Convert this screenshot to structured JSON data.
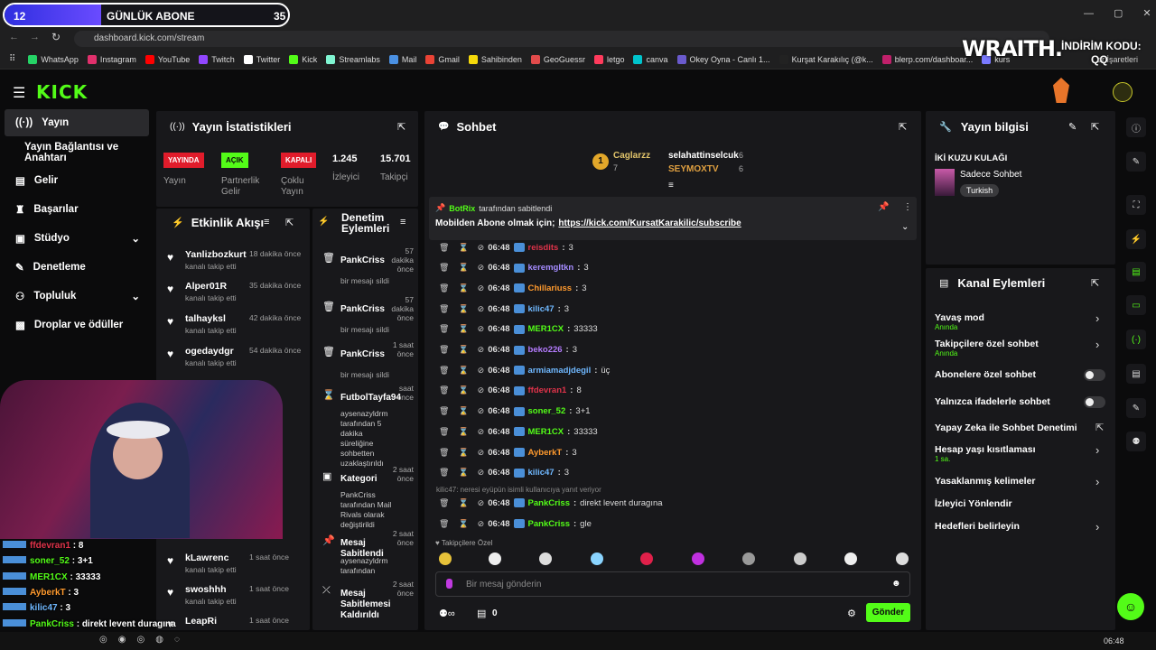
{
  "sub_goal": {
    "current": "12",
    "label": "GÜNLÜK ABONE",
    "target": "35",
    "progress": 0.34
  },
  "browser": {
    "url": "dashboard.kick.com/stream",
    "other_bookmarks": "er İşaretleri"
  },
  "bookmarks": [
    "WhatsApp",
    "Instagram",
    "YouTube",
    "Twitch",
    "Twitter",
    "Kick",
    "Streamlabs",
    "Mail",
    "Gmail",
    "Sahibinden",
    "GeoGuessr",
    "letgo",
    "canva",
    "Okey Oyna - Canlı 1...",
    "Kurşat Karakılıç (@k...",
    "blerp.com/dashboar...",
    "kurs"
  ],
  "promo": {
    "brand": "WRAITH.",
    "label": "İNDİRİM KODU:",
    "code": "QQ"
  },
  "sidebar": {
    "items": [
      "Yayın",
      "Yayın Bağlantısı ve Anahtarı",
      "Gelir",
      "Başarılar",
      "Stüdyo",
      "Denetleme",
      "Topluluk",
      "Droplar ve ödüller"
    ]
  },
  "stats": {
    "title": "Yayın İstatistikleri",
    "badges": [
      {
        "text": "YAYINDA",
        "label": "Yayın",
        "color": "#e11c2b",
        "fg": "#fff"
      },
      {
        "text": "AÇIK",
        "label": "Partnerlik Gelir Programı",
        "color": "#53fc18",
        "fg": "#0b0b0c"
      },
      {
        "text": "KAPALI",
        "label": "Çoklu Yayın",
        "color": "#e11c2b",
        "fg": "#fff"
      }
    ],
    "viewers": {
      "value": "1.245",
      "label": "İzleyici"
    },
    "followers": {
      "value": "15.701",
      "label": "Takipçi"
    }
  },
  "activity": {
    "title": "Etkinlik Akışı",
    "items": [
      {
        "name": "Yanlizbozkurt",
        "sub": "kanalı takip etti",
        "time": "18 dakika önce"
      },
      {
        "name": "Alper01R",
        "sub": "kanalı takip etti",
        "time": "35 dakika önce"
      },
      {
        "name": "talhayksl",
        "sub": "kanalı takip etti",
        "time": "42 dakika önce"
      },
      {
        "name": "ogedaydgr",
        "sub": "kanalı takip etti",
        "time": "54 dakika önce"
      },
      {
        "name": "kLawrenc",
        "sub": "kanalı takip etti",
        "time": "1 saat önce"
      },
      {
        "name": "swoshhh",
        "sub": "kanalı takip etti",
        "time": "1 saat önce"
      },
      {
        "name": "LeapRi",
        "sub": "",
        "time": "1 saat önce"
      }
    ]
  },
  "moderation": {
    "title": "Denetim Eylemleri",
    "items": [
      {
        "name": "PankCriss",
        "sub": "bir mesajı sildi",
        "time": "57 dakika önce"
      },
      {
        "name": "PankCriss",
        "sub": "bir mesajı sildi",
        "time": "57 dakika önce"
      },
      {
        "name": "PankCriss",
        "sub": "bir mesajı sildi",
        "time": "1 saat önce"
      },
      {
        "name": "FutbolTayfa94",
        "sub": "aysenazyldrm tarafından 5 dakika süreliğine sohbetten uzaklaştırıldı",
        "time": "saat önce"
      },
      {
        "name": "Kategori",
        "sub": "PankCriss tarafından Mail Rivals olarak değiştirildi",
        "time": "2 saat önce"
      },
      {
        "name": "Mesaj Sabitlendi",
        "sub": "aysenazyldrm tarafından",
        "time": "2 saat önce"
      },
      {
        "name": "Mesaj Sabitlemesi Kaldırıldı",
        "sub": "",
        "time": "2 saat önce"
      }
    ]
  },
  "chat": {
    "title": "Sohbet",
    "top_gifters": [
      {
        "name": "Caglarzz",
        "count": "7"
      },
      {
        "name": "selahattinselcuk",
        "count": "6"
      },
      {
        "name": "SEYMOXTV",
        "count": "6"
      }
    ],
    "pinned": {
      "by": "BotRix",
      "by_suffix": "tarafından sabitlendi",
      "text": "Mobilden Abone olmak için;",
      "link": "https://kick.com/KursatKarakilic/subscribe"
    },
    "messages": [
      {
        "time": "06:48",
        "user": "reisdits",
        "text": "3",
        "color": "#e0334a"
      },
      {
        "time": "06:48",
        "user": "keremgltkn",
        "text": "3",
        "color": "#a58cff"
      },
      {
        "time": "06:48",
        "user": "Chillariuss",
        "text": "3",
        "color": "#ff9a2e"
      },
      {
        "time": "06:48",
        "user": "kilic47",
        "text": "3",
        "color": "#6fb8ff"
      },
      {
        "time": "06:48",
        "user": "MER1CX",
        "text": "33333",
        "color": "#53fc18"
      },
      {
        "time": "06:48",
        "user": "beko226",
        "text": "3",
        "color": "#b57cff"
      },
      {
        "time": "06:48",
        "user": "armiamadjdegil",
        "text": "üç",
        "color": "#6fb8ff"
      },
      {
        "time": "06:48",
        "user": "ffdevran1",
        "text": "8",
        "color": "#e0334a"
      },
      {
        "time": "06:48",
        "user": "soner_52",
        "text": "3+1",
        "color": "#53fc18"
      },
      {
        "time": "06:48",
        "user": "MER1CX",
        "text": "33333",
        "color": "#53fc18"
      },
      {
        "time": "06:48",
        "user": "AyberkT",
        "text": "3",
        "color": "#ff9a2e"
      },
      {
        "time": "06:48",
        "user": "kilic47",
        "text": "3",
        "color": "#6fb8ff"
      }
    ],
    "reply_note": "kilic47: neresi eyüpün isimli kullanıcıya yanıt veriyor",
    "messages2": [
      {
        "time": "06:48",
        "user": "PankCriss",
        "text": "direkt levent duragına",
        "color": "#53fc18"
      },
      {
        "time": "06:48",
        "user": "PankCriss",
        "text": "gle",
        "color": "#53fc18"
      }
    ],
    "followers_only": "Takipçilere Özel",
    "placeholder": "Bir mesaj gönderin",
    "count": "0",
    "send": "Gönder"
  },
  "stream_info": {
    "title": "Yayın bilgisi",
    "stream_title": "İKİ KUZU KULAĞI",
    "category": "Sadece Sohbet",
    "tag": "Turkish"
  },
  "channel_actions": {
    "title": "Kanal Eylemleri",
    "items": [
      {
        "label": "Yavaş mod",
        "sub": "Anında"
      },
      {
        "label": "Takipçilere özel sohbet",
        "sub": "Anında"
      },
      {
        "label": "Abonelere özel sohbet",
        "sub": ""
      },
      {
        "label": "Yalnızca ifadelerle sohbet",
        "sub": ""
      },
      {
        "label": "Yapay Zeka ile Sohbet Denetimi",
        "sub": ""
      },
      {
        "label": "Hesap yaşı kısıtlaması",
        "sub": "1 sa."
      },
      {
        "label": "Yasaklanmış kelimeler",
        "sub": ""
      },
      {
        "label": "İzleyici Yönlendir",
        "sub": ""
      },
      {
        "label": "Hedefleri belirleyin",
        "sub": ""
      }
    ]
  },
  "overlay_chat": [
    {
      "user": "ffdevran1",
      "text": "8",
      "color": "#e0334a"
    },
    {
      "user": "soner_52",
      "text": "3+1",
      "color": "#53fc18"
    },
    {
      "user": "MER1CX",
      "text": "33333",
      "color": "#53fc18"
    },
    {
      "user": "AyberkT",
      "text": "3",
      "color": "#ff9a2e"
    },
    {
      "user": "kilic47",
      "text": "3",
      "color": "#6fb8ff"
    },
    {
      "user": "PankCriss",
      "text": "direkt levent duragına",
      "color": "#53fc18"
    },
    {
      "user": "PankCriss",
      "text": "gle",
      "color": "#53fc18"
    }
  ],
  "taskbar": {
    "clock": "06:48"
  },
  "colors": {
    "accent": "#53fc18",
    "panel": "#18181b",
    "bg": "#0b0b0c"
  }
}
